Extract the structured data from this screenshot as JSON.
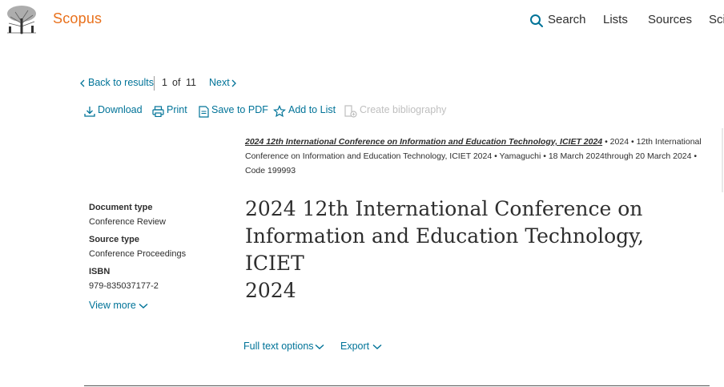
{
  "header": {
    "brand": "Scopus",
    "nav": {
      "search": "Search",
      "lists": "Lists",
      "sources": "Sources",
      "sci": "Sci"
    }
  },
  "result_nav": {
    "back": "Back to results",
    "position": "1",
    "of_label": "of",
    "total": "11",
    "next": "Next"
  },
  "toolbar": {
    "download": "Download",
    "print": "Print",
    "save_pdf": "Save to PDF",
    "add_list": "Add to List",
    "create_bib": "Create bibliography"
  },
  "source": {
    "title": "2024 12th International Conference on Information and Education Technology, ICIET 2024",
    "year": "2024",
    "conf_name_1": "12th International",
    "conf_name_2": "Conference on Information and Education Technology, ICIET 2024",
    "location": "Yamaguchi",
    "dates": "18 March 2024through 20 March 2024",
    "code": "Code 199993",
    "bullet": "•"
  },
  "details": {
    "doc_type_label": "Document type",
    "doc_type_value": "Conference Review",
    "source_type_label": "Source type",
    "source_type_value": "Conference Proceedings",
    "isbn_label": "ISBN",
    "isbn_value": "979-835037177-2",
    "view_more": "View more"
  },
  "document": {
    "title_line1": "2024 12th International Conference on",
    "title_line2": "Information and Education Technology, ICIET",
    "title_line3": "2024"
  },
  "options": {
    "full_text": "Full text options",
    "export": "Export"
  },
  "colors": {
    "brand": "#e9711c",
    "link": "#007398",
    "text": "#2e2e2e",
    "disabled": "#bfbfbf"
  }
}
